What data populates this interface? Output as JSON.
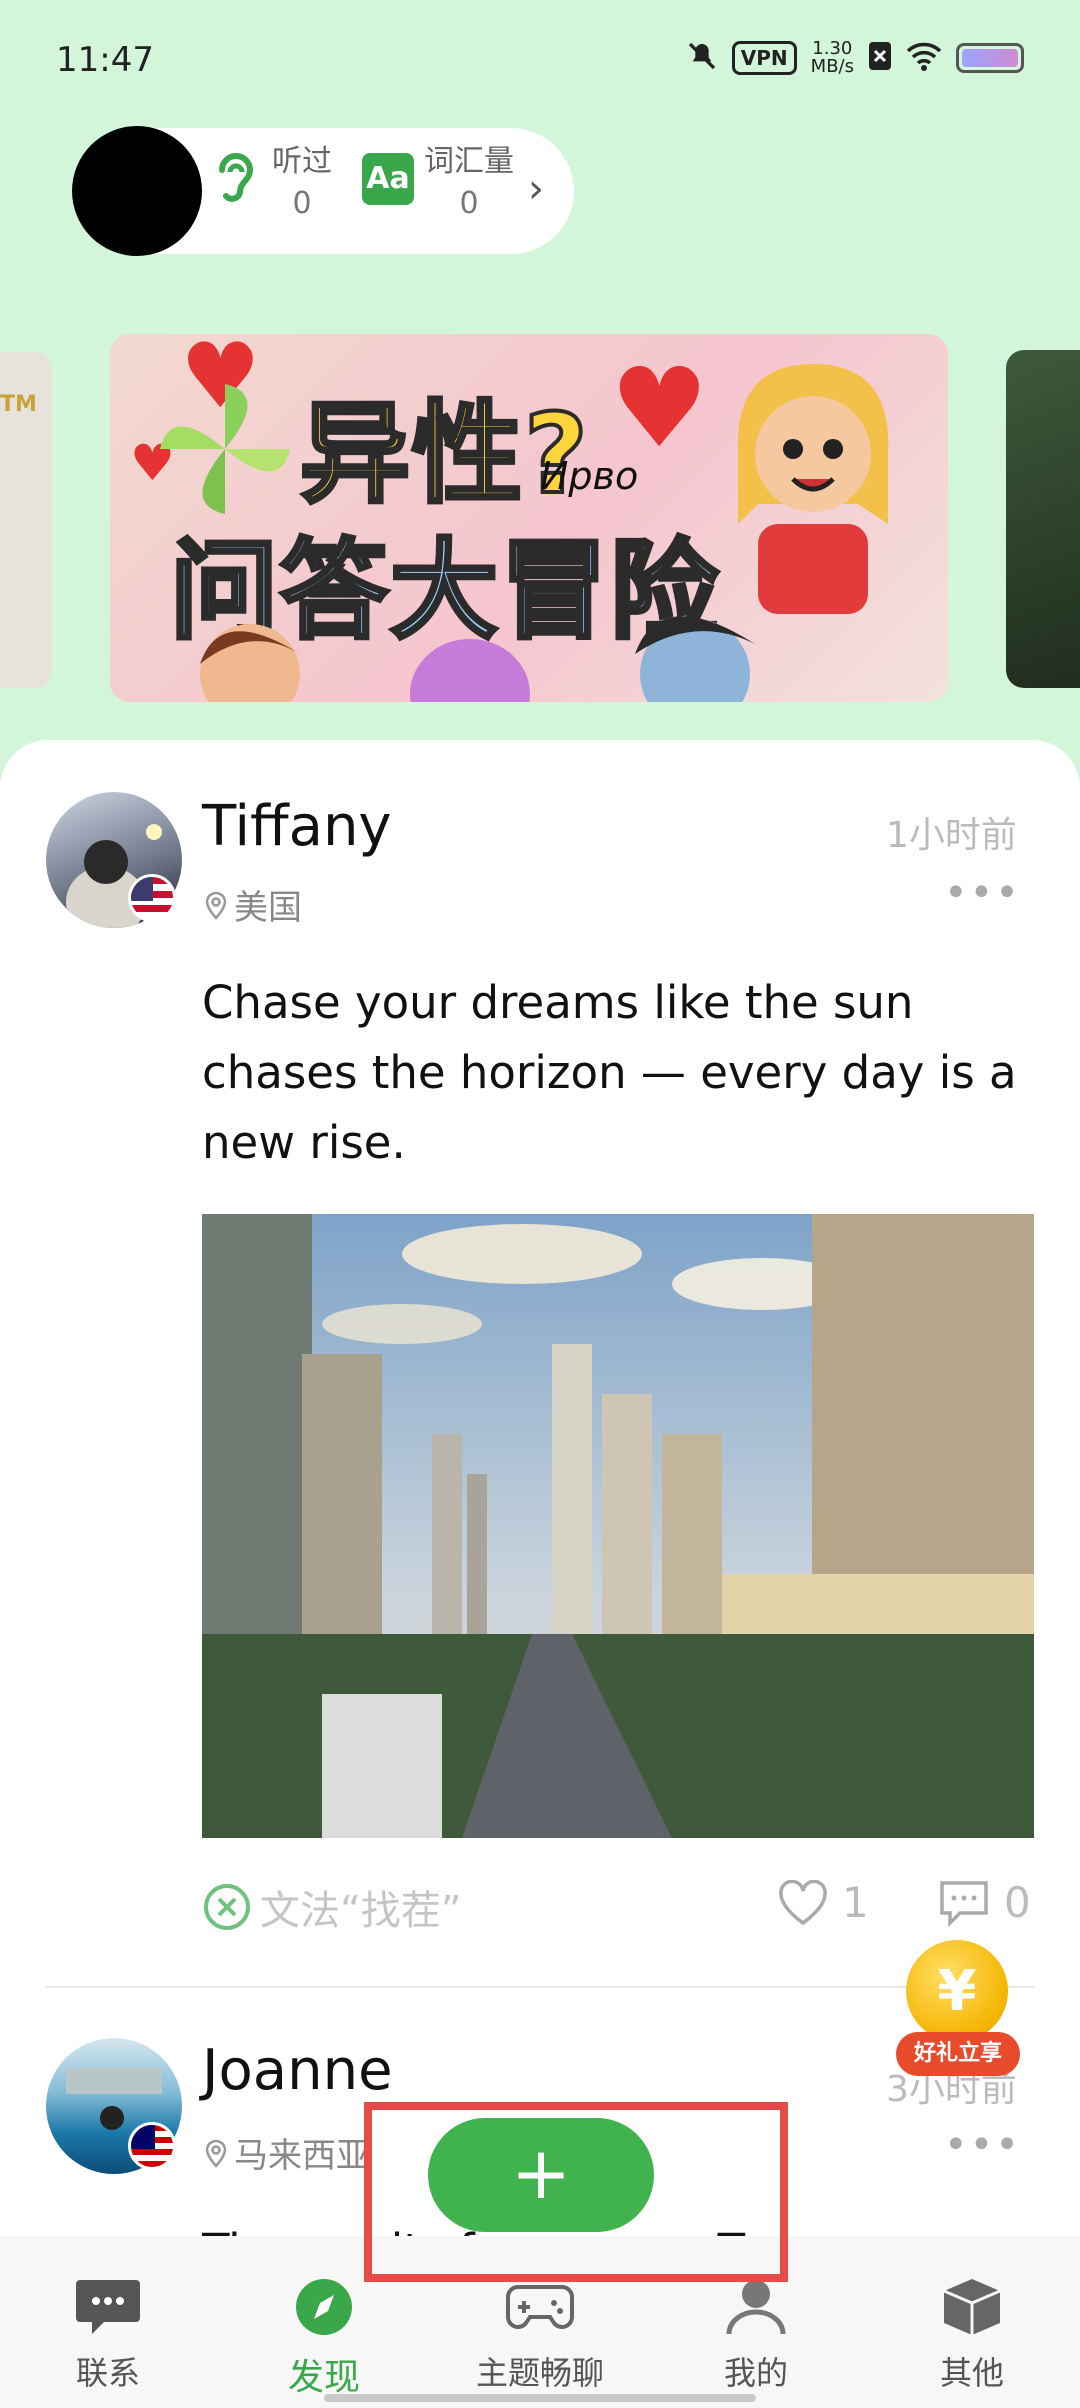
{
  "status_bar": {
    "time": "11:47",
    "vpn": "VPN",
    "speed_value": "1.30",
    "speed_unit": "MB/s"
  },
  "profile": {
    "listened_label": "听过",
    "listened_value": "0",
    "vocab_label": "词汇量",
    "vocab_value": "0",
    "vocab_icon_text": "Aa"
  },
  "banner": {
    "left_card_text": "TM",
    "title_line1": "异性?",
    "title_line2": "问答大冒险",
    "tag": "Ирво"
  },
  "posts": [
    {
      "username": "Tiffany",
      "location": "美国",
      "time_ago": "1小时前",
      "text": "Chase your dreams like the sun chases the horizon — every day is a new rise.",
      "grammar_label": "文法“找茬”",
      "likes": "1",
      "comments": "0"
    },
    {
      "username": "Joanne",
      "location": "马来西亚",
      "time_ago": "3小时前",
      "text": "Time waits for no one. Treasure"
    }
  ],
  "reward": {
    "coin_symbol": "¥",
    "label": "好礼立享"
  },
  "fab": {
    "symbol": "+"
  },
  "nav": [
    {
      "label": "联系",
      "icon": "chat-icon"
    },
    {
      "label": "发现",
      "icon": "compass-icon"
    },
    {
      "label": "主题畅聊",
      "icon": "gamepad-icon"
    },
    {
      "label": "我的",
      "icon": "person-icon"
    },
    {
      "label": "其他",
      "icon": "box-icon"
    }
  ],
  "colors": {
    "background": "#d3f5d9",
    "accent": "#40b34f",
    "highlight_box": "#e84a4a"
  }
}
